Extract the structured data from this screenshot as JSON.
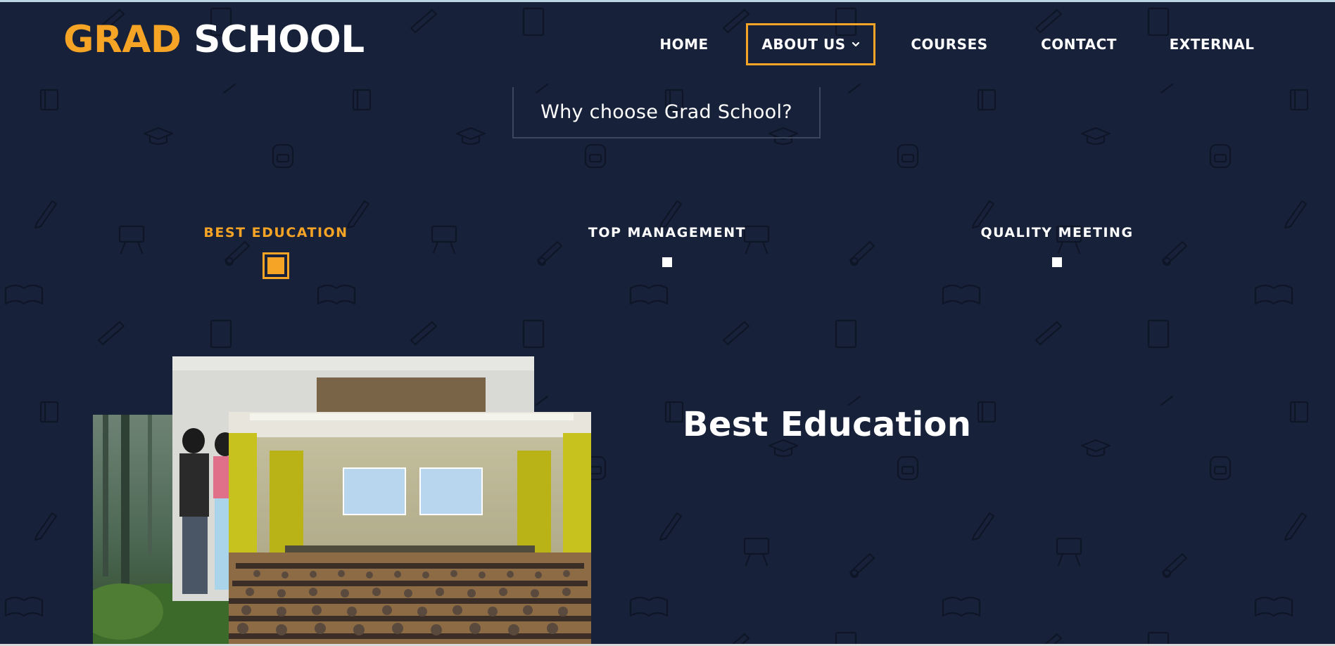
{
  "logo": {
    "part1": "GRAD",
    "part2": "SCHOOL"
  },
  "nav": {
    "items": [
      {
        "label": "HOME"
      },
      {
        "label": "ABOUT US",
        "active": true,
        "has_dropdown": true
      },
      {
        "label": "COURSES"
      },
      {
        "label": "CONTACT"
      },
      {
        "label": "EXTERNAL"
      }
    ]
  },
  "section": {
    "heading": "Why choose Grad School?"
  },
  "tabs": [
    {
      "label": "BEST EDUCATION",
      "active": true
    },
    {
      "label": "TOP MANAGEMENT"
    },
    {
      "label": "QUALITY MEETING"
    }
  ],
  "content": {
    "title": "Best Education"
  },
  "colors": {
    "accent": "#f5a425",
    "background": "#172139",
    "text": "#ffffff"
  },
  "icons": [
    "chevron-down-icon"
  ]
}
